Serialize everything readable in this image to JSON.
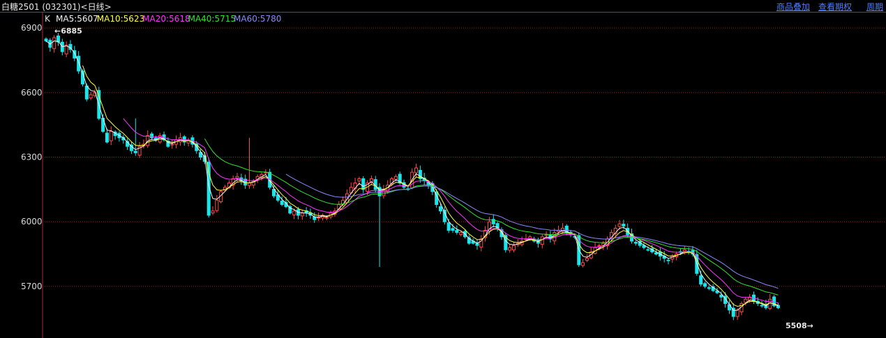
{
  "header": {
    "title": "白糖2501 (032301)<日线>",
    "links": [
      "商品叠加",
      "查看期权",
      "周期"
    ]
  },
  "legend": {
    "k_label": "K",
    "ma": [
      {
        "label": "MA5:5607",
        "color": "#f4f4f4"
      },
      {
        "label": "MA10:5623",
        "color": "#ffff3c"
      },
      {
        "label": "MA20:5618",
        "color": "#ff34ff"
      },
      {
        "label": "MA40:5715",
        "color": "#2ee32e"
      },
      {
        "label": "MA60:5780",
        "color": "#8a8aff"
      }
    ]
  },
  "colors": {
    "up": "#ff4a4a",
    "down": "#19e6ea",
    "grid": "#9c1f1f",
    "axis": "#b02a2a",
    "background": "#000000"
  },
  "chart_data": {
    "type": "candlestick",
    "y_ticks": [
      5700,
      6000,
      6300,
      6600,
      6900
    ],
    "ylim": [
      5460,
      6975
    ],
    "grid": "horizontal dotted",
    "annotations": {
      "high": "6885",
      "low": "5508"
    },
    "ma_lines": [
      {
        "name": "MA5",
        "color": "#f4f4f4",
        "smooth": 0.5
      },
      {
        "name": "MA10",
        "color": "#ffff3c",
        "smooth": 0.32
      },
      {
        "name": "MA20",
        "color": "#ff34ff",
        "smooth": 0.17
      },
      {
        "name": "MA40",
        "color": "#2ee32e",
        "smooth": 0.09
      },
      {
        "name": "MA60",
        "color": "#8a8aff",
        "smooth": 0.065
      }
    ],
    "ma_start": [
      0,
      9,
      19,
      39,
      59
    ],
    "closes": [
      6840,
      6810,
      6855,
      6835,
      6790,
      6820,
      6800,
      6760,
      6700,
      6640,
      6570,
      6590,
      6600,
      6480,
      6420,
      6370,
      6420,
      6400,
      6390,
      6380,
      6350,
      6330,
      6320,
      6350,
      6360,
      6400,
      6390,
      6380,
      6400,
      6380,
      6350,
      6360,
      6380,
      6390,
      6370,
      6380,
      6360,
      6330,
      6300,
      6280,
      6030,
      6050,
      6100,
      6140,
      6160,
      6180,
      6200,
      6210,
      6190,
      6170,
      6180,
      6190,
      6210,
      6220,
      6230,
      6160,
      6120,
      6100,
      6080,
      6070,
      6040,
      6050,
      6030,
      6040,
      6040,
      6030,
      6010,
      6020,
      6030,
      6020,
      6040,
      6050,
      6080,
      6100,
      6130,
      6160,
      6180,
      6200,
      6150,
      6180,
      6200,
      6150,
      6120,
      6150,
      6170,
      6200,
      6210,
      6180,
      6160,
      6150,
      6230,
      6250,
      6200,
      6190,
      6170,
      6140,
      6080,
      6050,
      6000,
      5960,
      5960,
      5950,
      5950,
      5930,
      5900,
      5900,
      5890,
      5920,
      5960,
      6000,
      5990,
      5970,
      5930,
      5870,
      5880,
      5890,
      5900,
      5910,
      5920,
      5930,
      5910,
      5900,
      5930,
      5940,
      5920,
      5950,
      5960,
      5970,
      5950,
      5940,
      5930,
      5800,
      5810,
      5830,
      5860,
      5880,
      5890,
      5900,
      5920,
      5950,
      5970,
      5990,
      5980,
      5940,
      5910,
      5900,
      5890,
      5880,
      5870,
      5860,
      5850,
      5840,
      5830,
      5820,
      5840,
      5850,
      5860,
      5870,
      5860,
      5850,
      5760,
      5710,
      5700,
      5690,
      5680,
      5670,
      5650,
      5620,
      5590,
      5560,
      5590,
      5620,
      5640,
      5650,
      5630,
      5620,
      5610,
      5600,
      5640,
      5610,
      5600
    ]
  }
}
